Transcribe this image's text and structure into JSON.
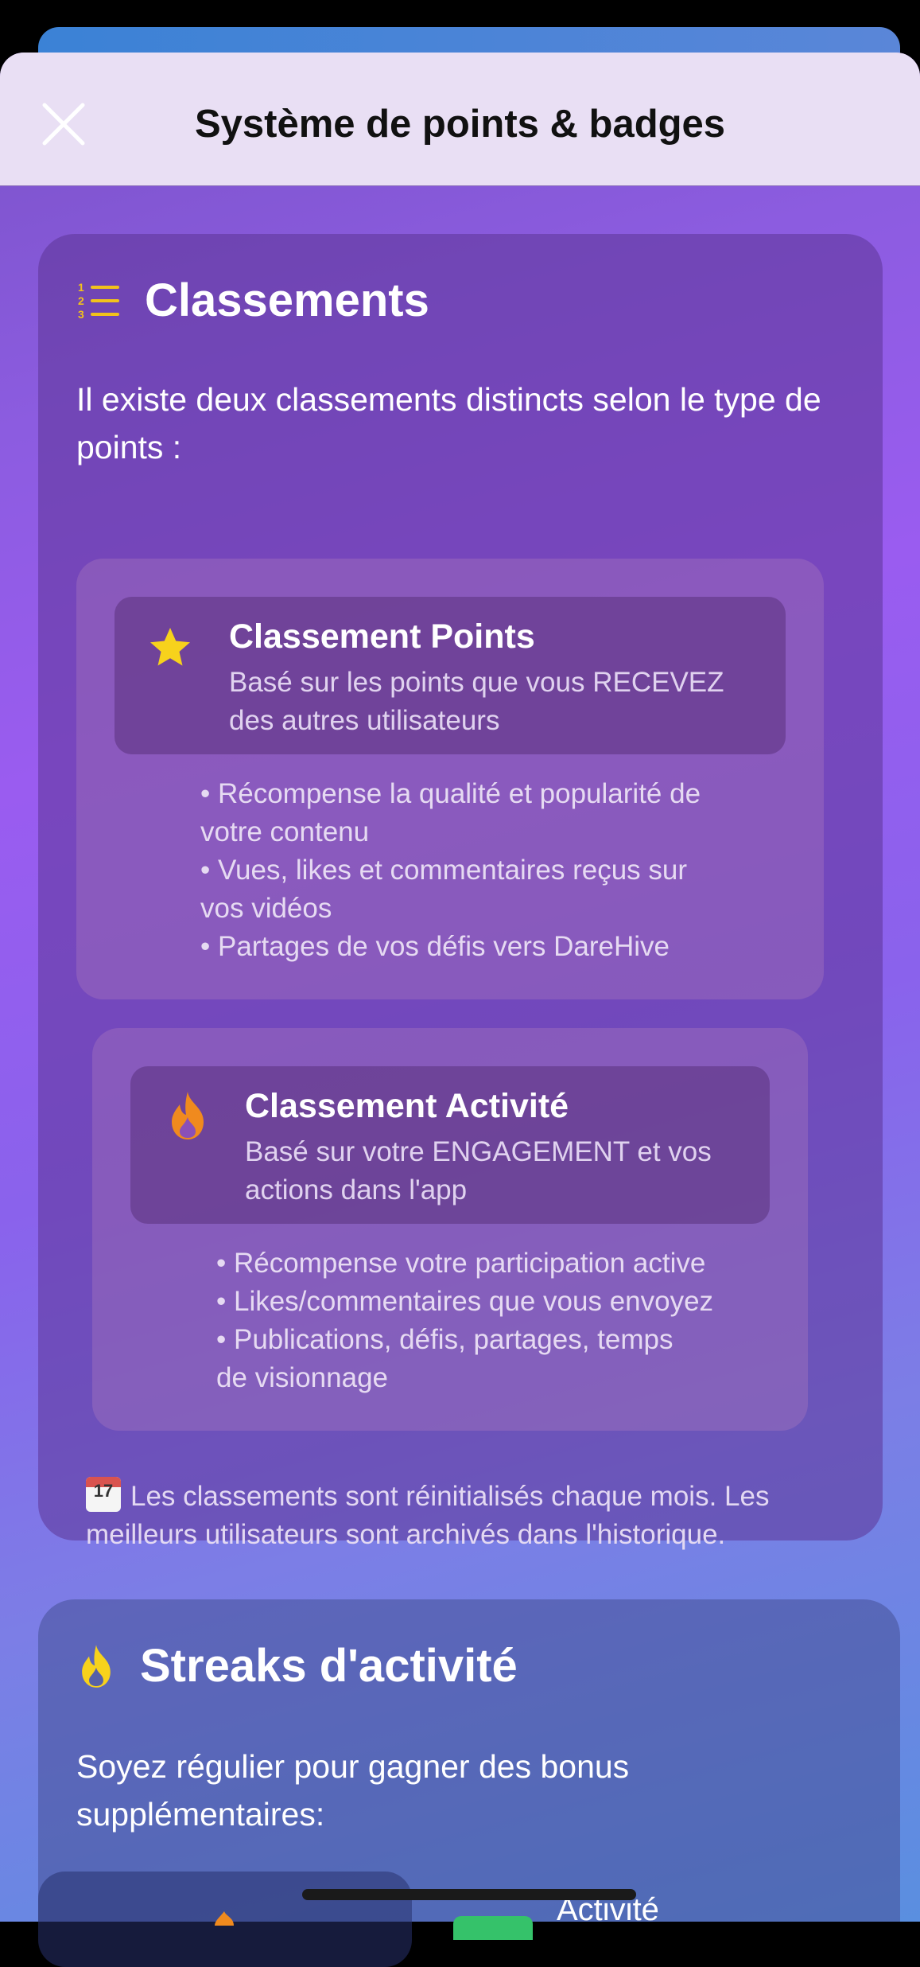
{
  "colors": {
    "accent_yellow": "#f2c21b",
    "accent_orange": "#f08a1e",
    "navbar_bg": "#e9dff4"
  },
  "navbar": {
    "title": "Système de points & badges",
    "close_icon": "close-icon"
  },
  "rankings": {
    "title": "Classements",
    "icon": "numbered-list-icon",
    "intro": "Il existe deux classements distincts selon le type de points :",
    "points": {
      "icon": "star-icon",
      "title": "Classement Points",
      "desc_line1": "Basé sur les points que vous RECEVEZ",
      "desc_line2": "des autres utilisateurs",
      "bullets": [
        "• Récompense la qualité et popularité de",
        "votre contenu",
        "• Vues, likes et commentaires reçus sur",
        "vos vidéos",
        "• Partages de vos défis vers DareHive"
      ]
    },
    "activity": {
      "icon": "flame-icon",
      "title": "Classement Activité",
      "desc_line1": "Basé sur votre ENGAGEMENT et vos",
      "desc_line2": "actions dans l'app",
      "bullets": [
        "• Récompense votre participation active",
        "• Likes/commentaires que vous envoyez",
        "• Publications, défis, partages, temps",
        "de visionnage"
      ]
    },
    "note_line1": "Les classements sont réinitialisés chaque mois. Les",
    "note_line2": "meilleurs utilisateurs sont archivés dans l'historique.",
    "note_icon": "calendar-icon",
    "calendar_day": "17"
  },
  "streaks": {
    "title": "Streaks d'activité",
    "icon": "flame-icon",
    "intro": "Soyez régulier pour gagner des bonus supplémentaires:",
    "activity_label": "Activité"
  }
}
